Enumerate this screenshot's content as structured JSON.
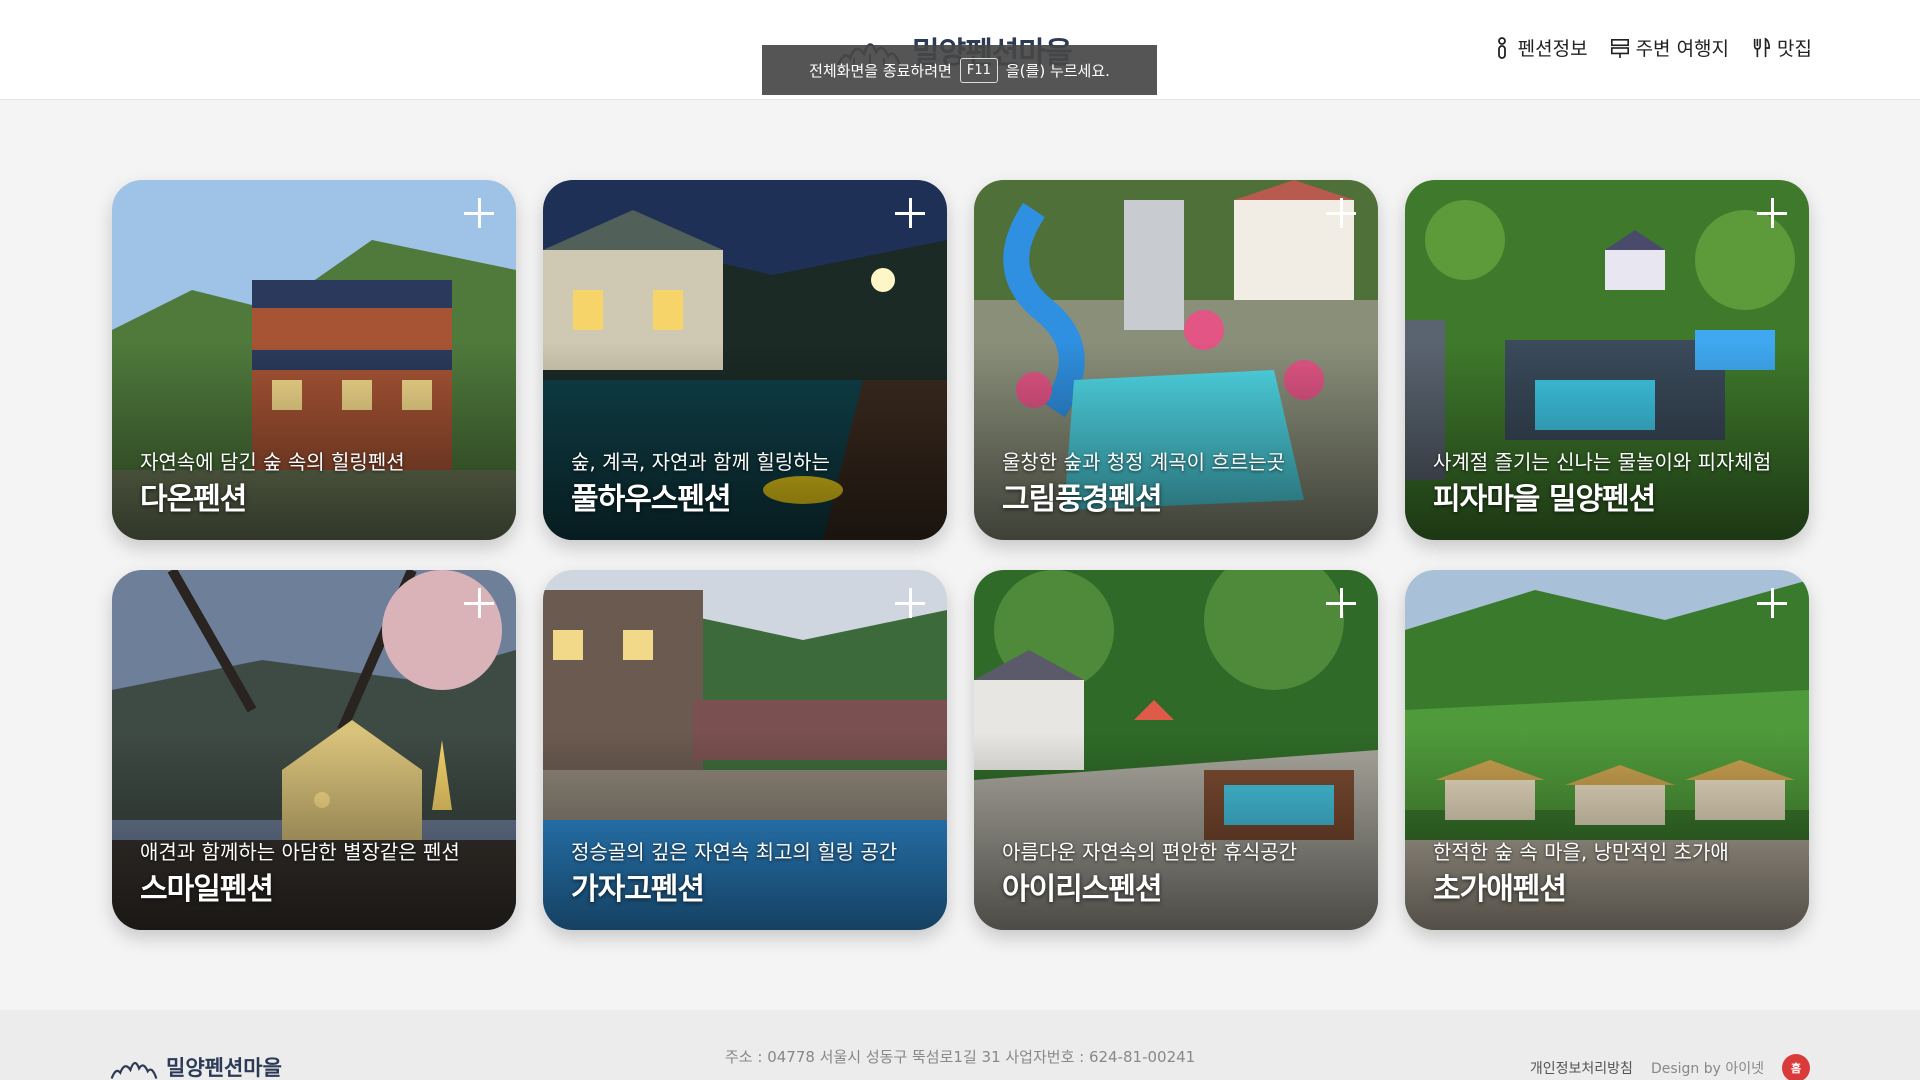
{
  "header": {
    "logo_text": "밀양펜션마을",
    "nav": [
      {
        "label": "펜션정보",
        "icon": "info-icon"
      },
      {
        "label": "주변 여행지",
        "icon": "signpost-icon"
      },
      {
        "label": "맛집",
        "icon": "utensils-icon"
      }
    ]
  },
  "fullscreen_notice": {
    "before": "전체화면을 종료하려면",
    "key": "F11",
    "after": "을(를) 누르세요."
  },
  "cards": [
    {
      "subtitle": "자연속에 담긴 숲 속의 힐링펜션",
      "name": "다온펜션"
    },
    {
      "subtitle": "숲, 계곡, 자연과 함께 힐링하는",
      "name": "풀하우스펜션"
    },
    {
      "subtitle": "울창한 숲과 청정 계곡이 흐르는곳",
      "name": "그림풍경펜션"
    },
    {
      "subtitle": "사계절 즐기는 신나는 물놀이와 피자체험",
      "name": "피자마을 밀양펜션"
    },
    {
      "subtitle": "애견과 함께하는 아담한 별장같은 펜션",
      "name": "스마일펜션"
    },
    {
      "subtitle": "정승골의 깊은 자연속 최고의 힐링 공간",
      "name": "가자고펜션"
    },
    {
      "subtitle": "아름다운 자연속의 편안한 휴식공간",
      "name": "아이리스펜션"
    },
    {
      "subtitle": "한적한 숲 속 마을, 낭만적인 초가애",
      "name": "초가애펜션"
    }
  ],
  "footer": {
    "logo_text": "밀양펜션마을",
    "address": "주소 : 04778 서울시 성동구 뚝섬로1길 31    사업자번호 : 624-81-00241",
    "privacy": "개인정보처리방침",
    "design": "Design by 아이넷",
    "badge": "홈"
  },
  "colors": {
    "brand": "#2b3a55",
    "background": "#f4f4f4",
    "badge": "#d93b3b"
  }
}
